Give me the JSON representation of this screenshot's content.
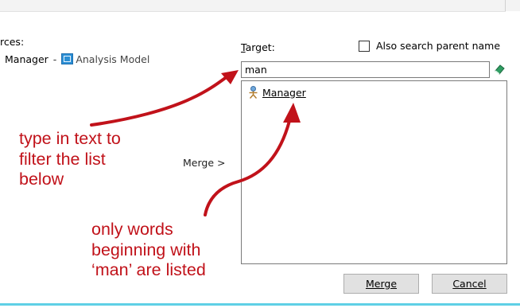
{
  "sources": {
    "label": "rces:",
    "item": "Manager",
    "separator": "-",
    "model": "Analysis Model"
  },
  "target": {
    "label_first_letter": "T",
    "label_rest": "arget:",
    "search_value": "man",
    "parent_option": "Also search parent name",
    "parent_checked": false
  },
  "list": {
    "items": [
      {
        "label": "Manager",
        "icon": "actor-icon"
      }
    ]
  },
  "actions": {
    "merge_side": "Merge >",
    "merge_button": "Merge",
    "cancel_button": "Cancel"
  },
  "annotations": {
    "filter_note": "type in text to\nfilter the list\nbelow",
    "result_note": "only words\nbeginning with\n‘man’ are listed"
  },
  "colors": {
    "annotation": "#c1121a",
    "accent_line": "#5fd0e6"
  }
}
